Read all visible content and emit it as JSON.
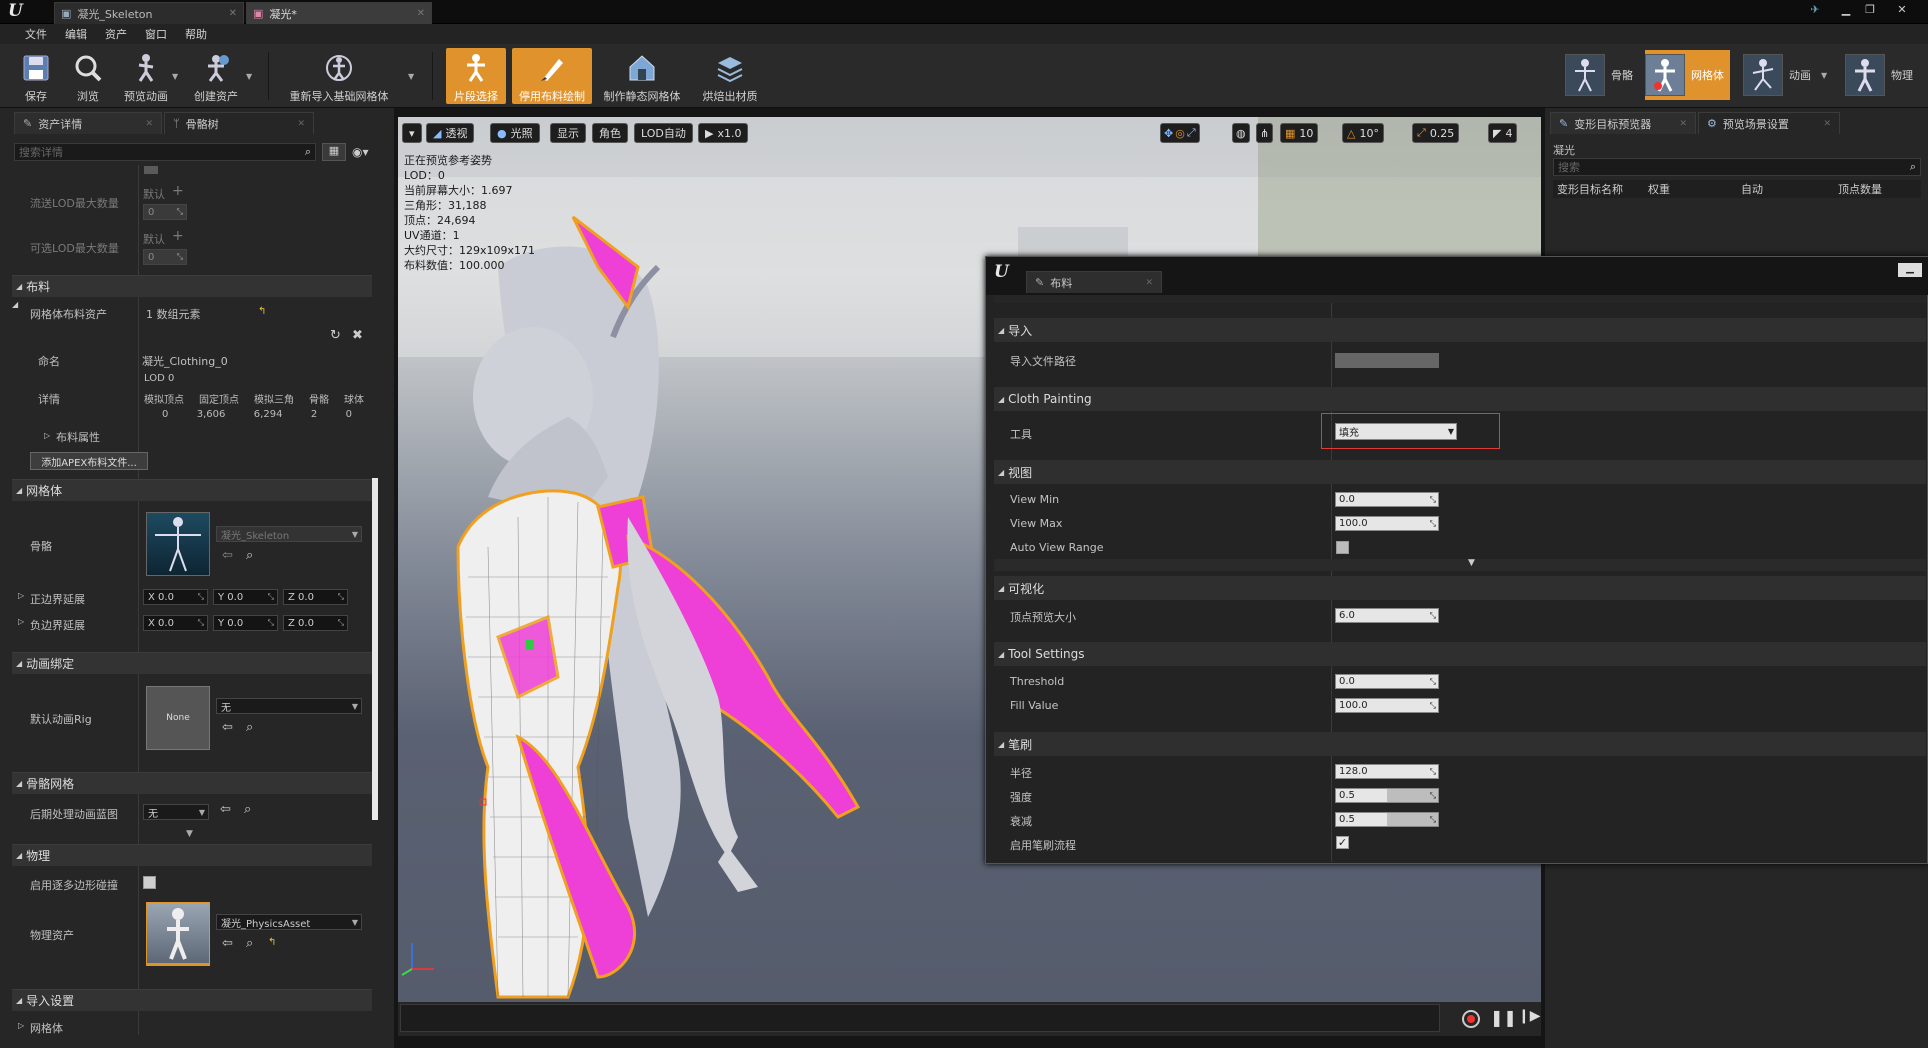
{
  "titlebar": {
    "tabs": [
      {
        "label": "凝光_Skeleton"
      },
      {
        "label": "凝光*"
      }
    ]
  },
  "menu": [
    "文件",
    "编辑",
    "资产",
    "窗口",
    "帮助"
  ],
  "toolbar": {
    "buttons": [
      {
        "label": "保存",
        "icon": "save-icon"
      },
      {
        "label": "浏览",
        "icon": "browse-icon"
      },
      {
        "label": "预览动画",
        "icon": "preview-animation-icon"
      },
      {
        "label": "创建资产",
        "icon": "create-asset-icon"
      },
      {
        "label": "重新导入基础网格体",
        "icon": "reimport-icon"
      },
      {
        "label": "片段选择",
        "icon": "section-select-icon"
      },
      {
        "label": "停用布料绘制",
        "icon": "cloth-paint-icon"
      },
      {
        "label": "制作静态网格体",
        "icon": "static-mesh-icon"
      },
      {
        "label": "烘焙出材质",
        "icon": "bake-material-icon"
      }
    ],
    "modes": [
      {
        "label": "骨骼"
      },
      {
        "label": "网格体"
      },
      {
        "label": "动画"
      },
      {
        "label": "物理"
      }
    ]
  },
  "left_panel": {
    "tabs": [
      {
        "label": "资产详情"
      },
      {
        "label": "骨骼树"
      }
    ],
    "search_placeholder": "搜索详情",
    "lod_rows": [
      {
        "label": "流送LOD最大数量",
        "default": "默认",
        "value": "0"
      },
      {
        "label": "可选LOD最大数量",
        "default": "默认",
        "value": "0"
      }
    ],
    "cloth": {
      "section": "布料",
      "asset_label": "网格体布料资产",
      "asset_value": "1 数组元素",
      "name_label": "命名",
      "name_value": "凝光_Clothing_0",
      "lod_label": "LOD 0",
      "details_label": "详情",
      "details_headers": [
        "模拟顶点",
        "固定顶点",
        "模拟三角",
        "骨骼",
        "球体"
      ],
      "details_values": [
        "0",
        "3,606",
        "6,294",
        "2",
        "0"
      ],
      "props_label": "布料属性",
      "add_button": "添加APEX布料文件..."
    },
    "mesh": {
      "section": "网格体",
      "skeleton_label": "骨骼",
      "skeleton_value": "凝光_Skeleton",
      "pos_bounds_label": "正边界延展",
      "neg_bounds_label": "负边界延展",
      "axes": [
        "X",
        "Y",
        "Z"
      ],
      "pos_values": [
        "0.0",
        "0.0",
        "0.0"
      ],
      "neg_values": [
        "0.0",
        "0.0",
        "0.0"
      ]
    },
    "anim_binding": {
      "section": "动画绑定",
      "rig_label": "默认动画Rig",
      "rig_thumb": "None",
      "rig_value": "无"
    },
    "skeletal_mesh": {
      "section": "骨骼网格",
      "postprocess_label": "后期处理动画蓝图",
      "postprocess_value": "无"
    },
    "physics": {
      "section": "物理",
      "per_poly_label": "启用逐多边形碰撞",
      "asset_label": "物理资产",
      "asset_value": "凝光_PhysicsAsset"
    },
    "import": {
      "section": "导入设置",
      "mesh_label": "网格体"
    }
  },
  "viewport": {
    "buttons": [
      {
        "label": "透视"
      },
      {
        "label": "光照"
      },
      {
        "label": "显示"
      },
      {
        "label": "角色"
      },
      {
        "label": "LOD自动"
      },
      {
        "label": "x1.0"
      }
    ],
    "snap_values": {
      "grid": "10",
      "angle": "10°",
      "scale": "0.25",
      "speed": "4"
    },
    "stats": [
      "正在预览参考姿势",
      "LOD：0",
      "当前屏幕大小：1.697",
      "三角形：31,188",
      "顶点：24,694",
      "UV通道：1",
      "大约尺寸：129x109x171",
      "布料数值：100.000"
    ]
  },
  "cloth_window": {
    "tab": "布料",
    "groups": {
      "import": "导入",
      "import_path_label": "导入文件路径",
      "cloth_painting": "Cloth Painting",
      "tool_label": "工具",
      "tool_value": "填充",
      "view": "视图",
      "view_min_label": "View Min",
      "view_min_value": "0.0",
      "view_max_label": "View Max",
      "view_max_value": "100.0",
      "auto_view_label": "Auto View Range",
      "visualization": "可视化",
      "point_size_label": "顶点预览大小",
      "point_size_value": "6.0",
      "tool_settings": "Tool Settings",
      "threshold_label": "Threshold",
      "threshold_value": "0.0",
      "fill_label": "Fill Value",
      "fill_value": "100.0",
      "brush": "笔刷",
      "radius_label": "半径",
      "radius_value": "128.0",
      "strength_label": "强度",
      "strength_value": "0.5",
      "falloff_label": "衰减",
      "falloff_value": "0.5",
      "flow_label": "启用笔刷流程"
    }
  },
  "right_panel": {
    "tabs": [
      {
        "label": "变形目标预览器"
      },
      {
        "label": "预览场景设置"
      }
    ],
    "mesh_name": "凝光",
    "search_placeholder": "搜索",
    "columns": [
      "变形目标名称",
      "权重",
      "自动",
      "顶点数量"
    ]
  },
  "colors": {
    "accent": "#e0932c",
    "cloth_magenta": "#ee3fd6",
    "highlight_box": "#e53935"
  }
}
